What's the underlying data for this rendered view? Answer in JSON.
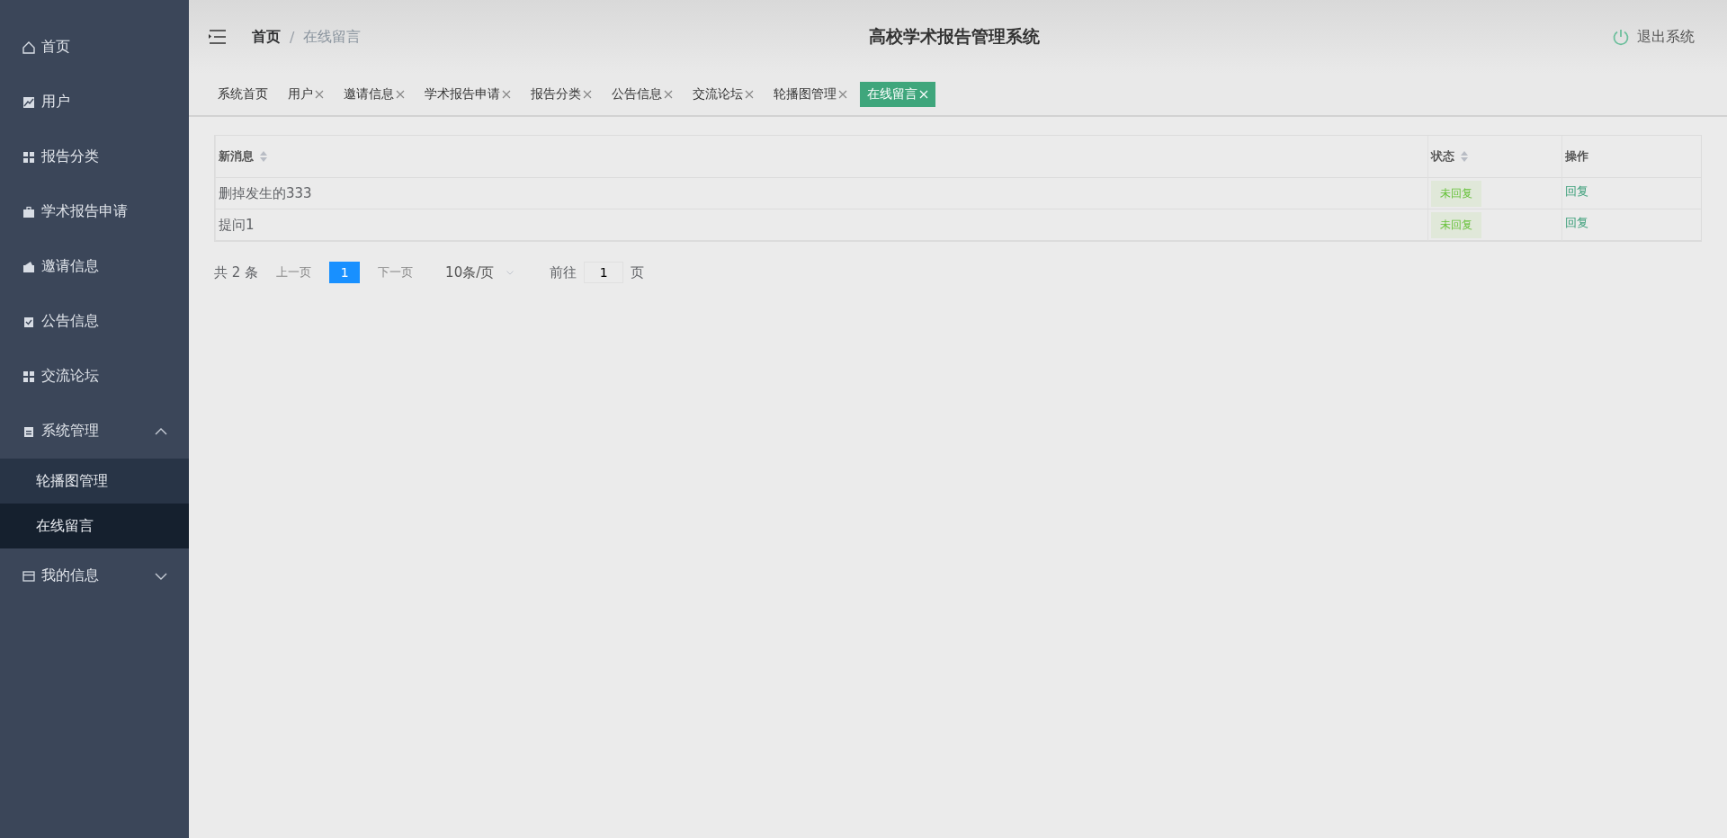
{
  "sidebar": {
    "items": [
      {
        "label": "首页",
        "kind": "home",
        "selected": false
      },
      {
        "label": "用户",
        "kind": "chart",
        "selected": false
      },
      {
        "label": "报告分类",
        "kind": "grid",
        "selected": false
      },
      {
        "label": "学术报告申请",
        "kind": "briefcase",
        "selected": false
      },
      {
        "label": "邀请信息",
        "kind": "wallet",
        "selected": false
      },
      {
        "label": "公告信息",
        "kind": "clipboard-check",
        "selected": false
      },
      {
        "label": "交流论坛",
        "kind": "grid",
        "selected": false
      },
      {
        "label": "系统管理",
        "kind": "clipboard",
        "selected": false,
        "expanded": true,
        "children": [
          {
            "label": "轮播图管理",
            "selected": false
          },
          {
            "label": "在线留言",
            "selected": true
          }
        ]
      },
      {
        "label": "我的信息",
        "kind": "card",
        "selected": false,
        "expanded": false
      }
    ]
  },
  "header": {
    "breadcrumb": [
      "首页",
      "在线留言"
    ],
    "separator": "/",
    "title": "高校学术报告管理系统",
    "logout": "退出系统"
  },
  "tabs": [
    {
      "label": "系统首页",
      "closable": false,
      "selected": false
    },
    {
      "label": "用户",
      "closable": true,
      "selected": false
    },
    {
      "label": "邀请信息",
      "closable": true,
      "selected": false
    },
    {
      "label": "学术报告申请",
      "closable": true,
      "selected": false
    },
    {
      "label": "报告分类",
      "closable": true,
      "selected": false
    },
    {
      "label": "公告信息",
      "closable": true,
      "selected": false
    },
    {
      "label": "交流论坛",
      "closable": true,
      "selected": false
    },
    {
      "label": "轮播图管理",
      "closable": true,
      "selected": false
    },
    {
      "label": "在线留言",
      "closable": true,
      "selected": true
    }
  ],
  "table": {
    "columns": [
      {
        "label": "新消息",
        "sortable": true
      },
      {
        "label": "状态",
        "sortable": true
      },
      {
        "label": "操作",
        "sortable": false
      }
    ],
    "rows": [
      {
        "message": "删掉发生的333",
        "status": "未回复",
        "action": "回复"
      },
      {
        "message": "提问1",
        "status": "未回复",
        "action": "回复"
      }
    ]
  },
  "pagination": {
    "total": "共 2 条",
    "prev": "上一页",
    "pages": [
      {
        "label": "1",
        "selected": true
      }
    ],
    "next": "下一页",
    "page_size": "10条/页",
    "goto_label": "前往",
    "goto_value": "1",
    "goto_suffix": "页"
  }
}
